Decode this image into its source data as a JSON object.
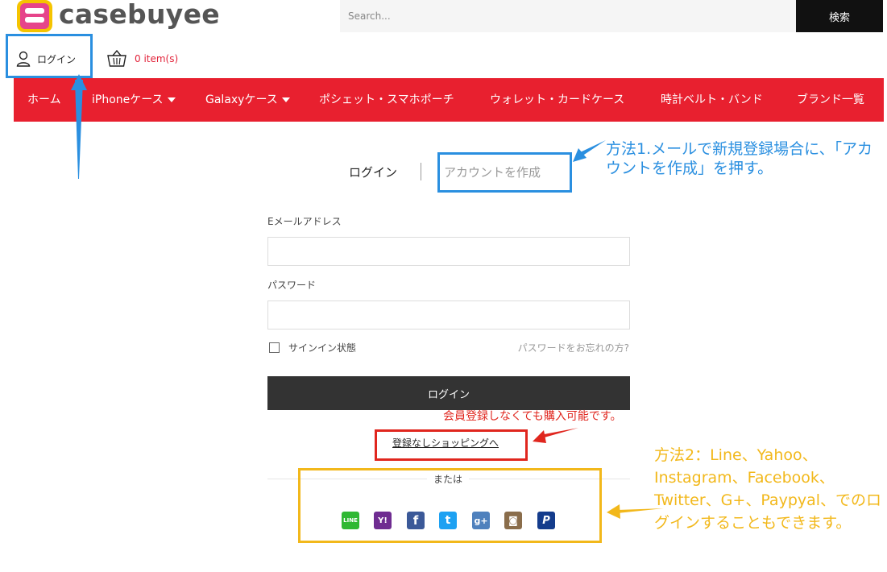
{
  "header": {
    "logo_text": "casebuyee",
    "search_placeholder": "Search...",
    "search_button": "検索",
    "login_label": "ログイン",
    "cart_count": "0 item(s)"
  },
  "nav": {
    "items": [
      {
        "label": "ホーム"
      },
      {
        "label": "iPhoneケース"
      },
      {
        "label": "Galaxyケース"
      },
      {
        "label": "ポシェット・スマホポーチ"
      },
      {
        "label": "ウォレット・カードケース"
      },
      {
        "label": "時計ベルト・バンド"
      },
      {
        "label": "ブランド一覧"
      }
    ]
  },
  "auth": {
    "tab_login": "ログイン",
    "tab_create": "アカウントを作成",
    "email_label": "Eメールアドレス",
    "password_label": "パスワード",
    "remember_label": "サインイン状態",
    "forgot_link": "パスワードをお忘れの方?",
    "login_button": "ログイン",
    "guest_link": "登録なしショッピングへ",
    "or_label": "または"
  },
  "social": [
    {
      "name": "Line",
      "glyph": "LINE",
      "color": "#2fb833"
    },
    {
      "name": "Yahoo",
      "glyph": "Y!",
      "color": "#6f2c91"
    },
    {
      "name": "Facebook",
      "glyph": "f",
      "color": "#3b5998"
    },
    {
      "name": "Twitter",
      "glyph": "t",
      "color": "#1da1f2"
    },
    {
      "name": "G+",
      "glyph": "g+",
      "color": "#4f81bd"
    },
    {
      "name": "Instagram",
      "glyph": "◙",
      "color": "#8a6d4b"
    },
    {
      "name": "Paypal",
      "glyph": "P",
      "color": "#143c8c"
    }
  ],
  "annotations": {
    "blue_note": "方法1.メールで新規登録場合に、「アカウントを作成」を押す。",
    "red_note": "会員登録しなくても購入可能です。",
    "yellow_note": "方法2：Line、Yahoo、Instagram、Facebook、Twitter、G+、Paypyal、でのログインすることもできます。"
  },
  "colors": {
    "nav_bg": "#e8202f",
    "annotation_blue": "#2a8fe0",
    "annotation_red": "#e0261e",
    "annotation_yellow": "#f2b81b"
  }
}
